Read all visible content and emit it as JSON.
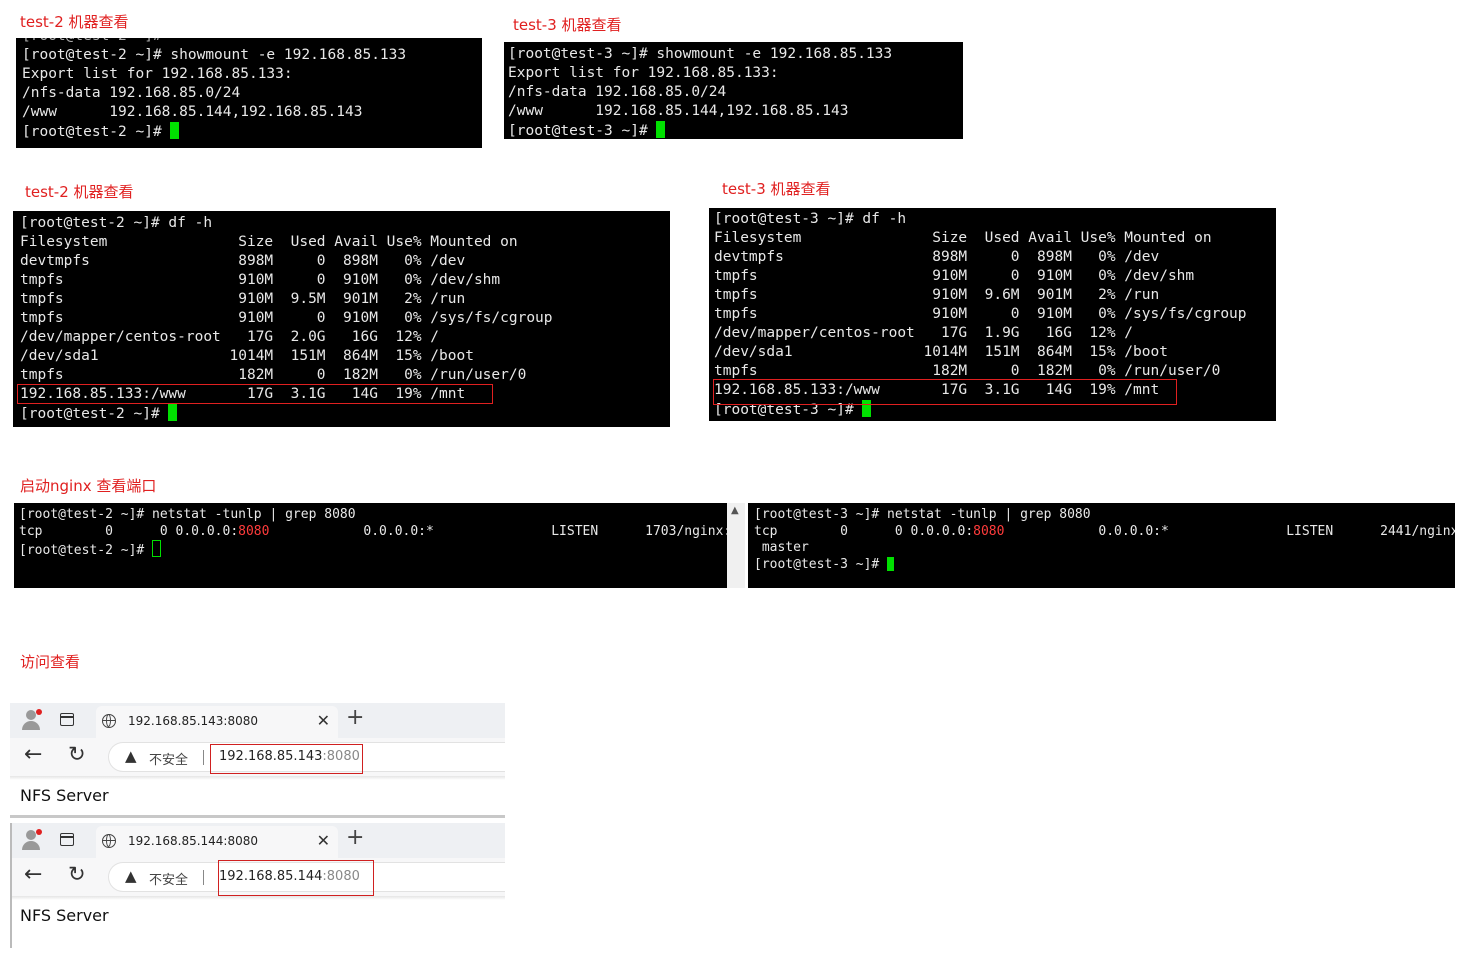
{
  "captions": {
    "top_left": "test-2 机器查看",
    "top_right": "test-3 机器查看",
    "mid_left": "test-2 机器查看",
    "mid_right": "test-3 机器查看",
    "nginx": "启动nginx 查看端口",
    "visit": "访问查看"
  },
  "showmount_test2": {
    "partial": "[root@test-2 ~]#",
    "lines": [
      "[root@test-2 ~]# showmount -e 192.168.85.133",
      "Export list for 192.168.85.133:",
      "/nfs-data 192.168.85.0/24",
      "/www      192.168.85.144,192.168.85.143"
    ],
    "prompt": "[root@test-2 ~]# "
  },
  "showmount_test3": {
    "lines": [
      "[root@test-3 ~]# showmount -e 192.168.85.133",
      "Export list for 192.168.85.133:",
      "/nfs-data 192.168.85.0/24",
      "/www      192.168.85.144,192.168.85.143"
    ],
    "prompt": "[root@test-3 ~]# "
  },
  "df_test2": {
    "lines": [
      "[root@test-2 ~]# df -h",
      "Filesystem               Size  Used Avail Use% Mounted on",
      "devtmpfs                 898M     0  898M   0% /dev",
      "tmpfs                    910M     0  910M   0% /dev/shm",
      "tmpfs                    910M  9.5M  901M   2% /run",
      "tmpfs                    910M     0  910M   0% /sys/fs/cgroup",
      "/dev/mapper/centos-root   17G  2.0G   16G  12% /",
      "/dev/sda1               1014M  151M  864M  15% /boot",
      "tmpfs                    182M     0  182M   0% /run/user/0",
      "192.168.85.133:/www       17G  3.1G   14G  19% /mnt"
    ],
    "prompt": "[root@test-2 ~]# "
  },
  "df_test3": {
    "lines": [
      "[root@test-3 ~]# df -h",
      "Filesystem               Size  Used Avail Use% Mounted on",
      "devtmpfs                 898M     0  898M   0% /dev",
      "tmpfs                    910M     0  910M   0% /dev/shm",
      "tmpfs                    910M  9.6M  901M   2% /run",
      "tmpfs                    910M     0  910M   0% /sys/fs/cgroup",
      "/dev/mapper/centos-root   17G  1.9G   16G  12% /",
      "/dev/sda1               1014M  151M  864M  15% /boot",
      "tmpfs                    182M     0  182M   0% /run/user/0",
      "192.168.85.133:/www       17G  3.1G   14G  19% /mnt"
    ],
    "prompt": "[root@test-3 ~]# "
  },
  "netstat_test2": {
    "cmd": "[root@test-2 ~]# netstat -tunlp | grep 8080",
    "row_pre": "tcp        0      0 0.0.0.0:",
    "port": "8080",
    "row_post": "            0.0.0.0:*               LISTEN      1703/nginx:",
    "prompt": "[root@test-2 ~]# "
  },
  "netstat_test3": {
    "cmd": "[root@test-3 ~]# netstat -tunlp | grep 8080",
    "row_pre": "tcp        0      0 0.0.0.0:",
    "port": "8080",
    "row_post": "            0.0.0.0:*               LISTEN      2441/nginx:",
    "cont": " master",
    "prompt": "[root@test-3 ~]# "
  },
  "browser1": {
    "tab_title": "192.168.85.143:8080",
    "insecure": "不安全",
    "host": "192.168.85.143",
    "port": ":8080",
    "page_text": "NFS Server"
  },
  "browser2": {
    "tab_title": "192.168.85.144:8080",
    "insecure": "不安全",
    "host": "192.168.85.144",
    "port": ":8080",
    "page_text": "NFS Server"
  }
}
